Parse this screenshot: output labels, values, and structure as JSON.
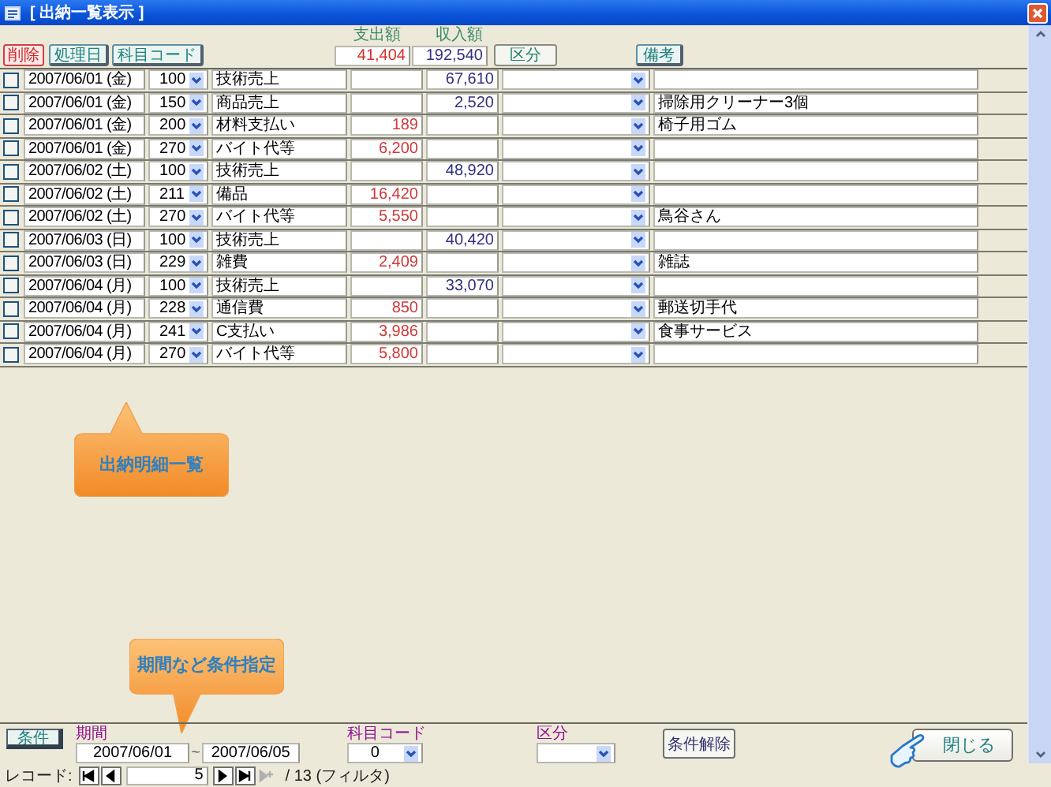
{
  "window": {
    "title": "[ 出納一覧表示 ]"
  },
  "header": {
    "delete_button": "削除",
    "sort_buttons": [
      "処理日",
      "科目コード"
    ],
    "expense_label": "支出額",
    "income_label": "収入額",
    "expense_total": "41,404",
    "income_total": "192,540",
    "category_button": "区分",
    "note_button": "備考"
  },
  "rows": [
    {
      "checked": false,
      "date": "2007/06/01 (金)",
      "code": "100",
      "subject": "技術売上",
      "income": "67,610"
    },
    {
      "checked": false,
      "date": "2007/06/01 (金)",
      "code": "150",
      "subject": "商品売上",
      "income": "2,520",
      "note": "掃除用クリーナー3個"
    },
    {
      "checked": false,
      "date": "2007/06/01 (金)",
      "code": "200",
      "subject": "材料支払い",
      "expense": "189",
      "note": "椅子用ゴム"
    },
    {
      "checked": false,
      "date": "2007/06/01 (金)",
      "code": "270",
      "subject": "バイト代等",
      "expense": "6,200"
    },
    {
      "checked": false,
      "date": "2007/06/02 (土)",
      "code": "100",
      "subject": "技術売上",
      "income": "48,920"
    },
    {
      "checked": false,
      "date": "2007/06/02 (土)",
      "code": "211",
      "subject": "備品",
      "expense": "16,420"
    },
    {
      "checked": false,
      "date": "2007/06/02 (土)",
      "code": "270",
      "subject": "バイト代等",
      "expense": "5,550",
      "note": "鳥谷さん"
    },
    {
      "checked": false,
      "date": "2007/06/03 (日)",
      "code": "100",
      "subject": "技術売上",
      "income": "40,420"
    },
    {
      "checked": false,
      "date": "2007/06/03 (日)",
      "code": "229",
      "subject": "雑費",
      "expense": "2,409",
      "note": "雑誌"
    },
    {
      "checked": false,
      "date": "2007/06/04 (月)",
      "code": "100",
      "subject": "技術売上",
      "income": "33,070"
    },
    {
      "checked": false,
      "date": "2007/06/04 (月)",
      "code": "228",
      "subject": "通信費",
      "expense": "850",
      "note": "郵送切手代"
    },
    {
      "checked": false,
      "date": "2007/06/04 (月)",
      "code": "241",
      "subject": "C支払い",
      "expense": "3,986",
      "note": "食事サービス"
    },
    {
      "checked": false,
      "date": "2007/06/04 (月)",
      "code": "270",
      "subject": "バイト代等",
      "expense": "5,800"
    }
  ],
  "callouts": [
    {
      "text": "出納明細一覧"
    },
    {
      "text": "期間など条件指定"
    }
  ],
  "filter": {
    "button": "条件",
    "period_label": "期間",
    "from": "2007/06/01",
    "separator": "~",
    "to": "2007/06/05",
    "code_label": "科目コード",
    "code_value": "0",
    "category_label": "区分",
    "clear_button": "条件解除",
    "close_button": "閉じる"
  },
  "record_nav": {
    "label": "レコード:",
    "buttons": [
      {
        "kind": "first",
        "disabled": false
      },
      {
        "kind": "prev",
        "disabled": false
      },
      {
        "kind": "next",
        "disabled": false
      },
      {
        "kind": "last",
        "disabled": false
      },
      {
        "kind": "new",
        "disabled": true
      }
    ],
    "current": "5",
    "total": "/ 13 (フィルタ)"
  }
}
